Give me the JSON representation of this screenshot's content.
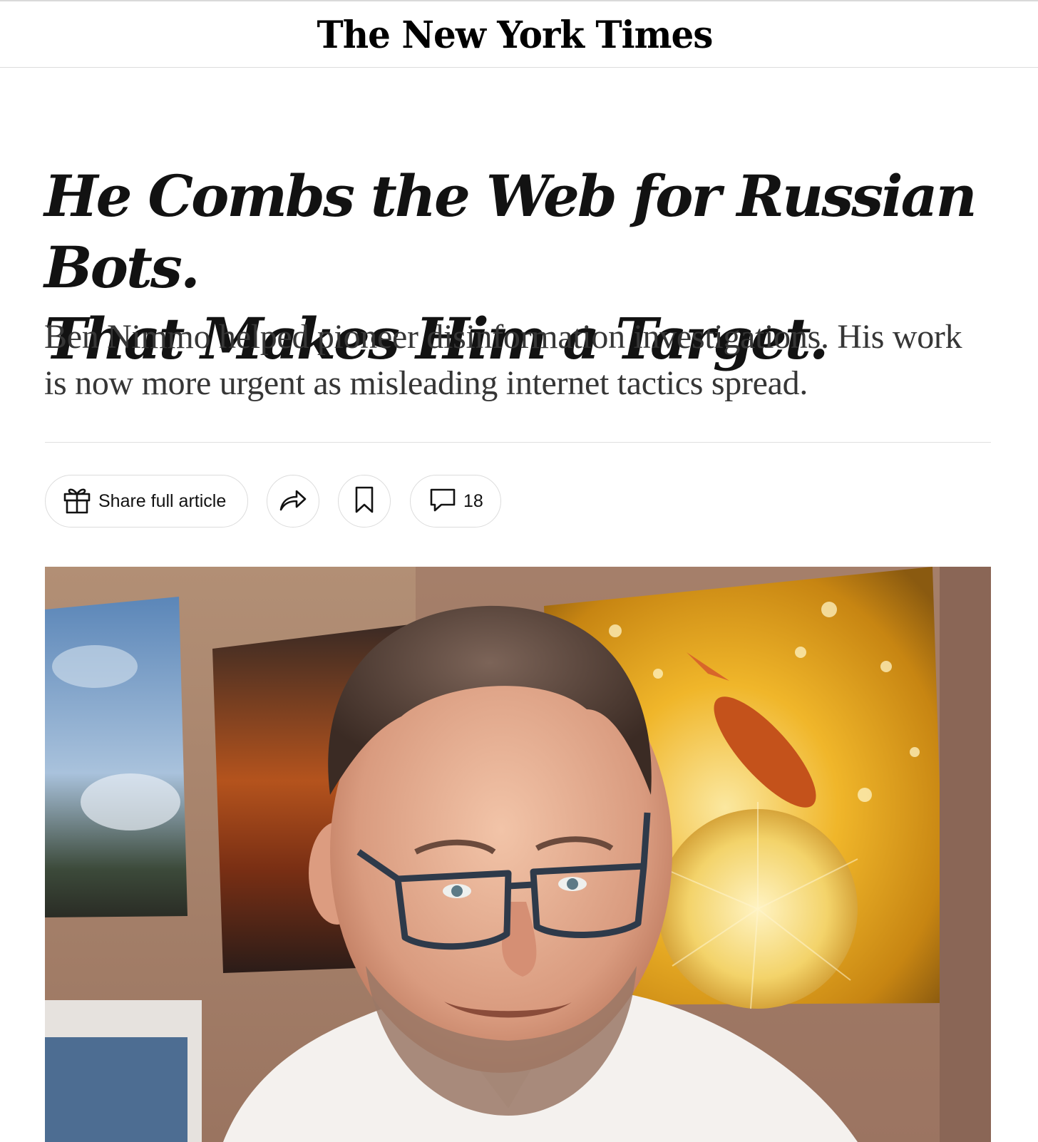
{
  "masthead": {
    "logo_text": "The New York Times"
  },
  "article": {
    "headline_line1": "He Combs the Web for Russian Bots.",
    "headline_line2": "That Makes Him a Target.",
    "summary": "Ben Nimmo helped pioneer disinformation investigations. His work is now more urgent as misleading internet tactics spread."
  },
  "actions": {
    "share_full_article_label": "Share full article",
    "gift_icon": "gift-icon",
    "share_icon": "share-arrow-icon",
    "bookmark_icon": "bookmark-icon",
    "comment_icon": "comment-bubble-icon",
    "comment_count": "18"
  },
  "colors": {
    "text": "#121212",
    "summary_text": "#363636",
    "border": "#dcdcdc"
  }
}
